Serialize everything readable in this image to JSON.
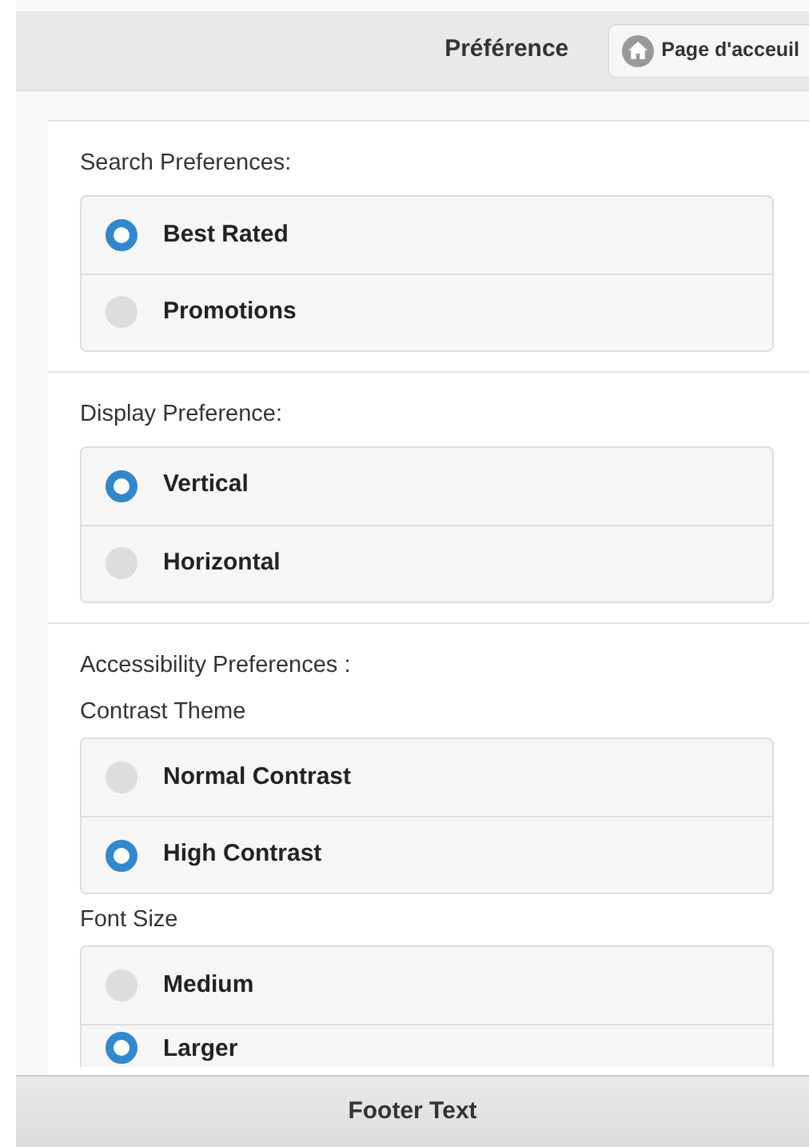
{
  "header": {
    "title": "Préférence",
    "home_button": {
      "label": "Page d'acceuil"
    }
  },
  "sections": [
    {
      "title": "Search Preferences:",
      "groups": [
        {
          "options": [
            {
              "label": "Best Rated",
              "selected": true
            },
            {
              "label": "Promotions",
              "selected": false
            }
          ]
        }
      ]
    },
    {
      "title": "Display Preference:",
      "groups": [
        {
          "options": [
            {
              "label": "Vertical",
              "selected": true
            },
            {
              "label": "Horizontal",
              "selected": false
            }
          ]
        }
      ]
    },
    {
      "title": "Accessibility Preferences :",
      "groups": [
        {
          "label": "Contrast Theme",
          "options": [
            {
              "label": "Normal Contrast",
              "selected": false
            },
            {
              "label": "High Contrast",
              "selected": true
            }
          ]
        },
        {
          "label": "Font Size",
          "options": [
            {
              "label": "Medium",
              "selected": false
            },
            {
              "label": "Larger",
              "selected": true
            }
          ]
        }
      ]
    }
  ],
  "footer": {
    "text": "Footer Text"
  }
}
